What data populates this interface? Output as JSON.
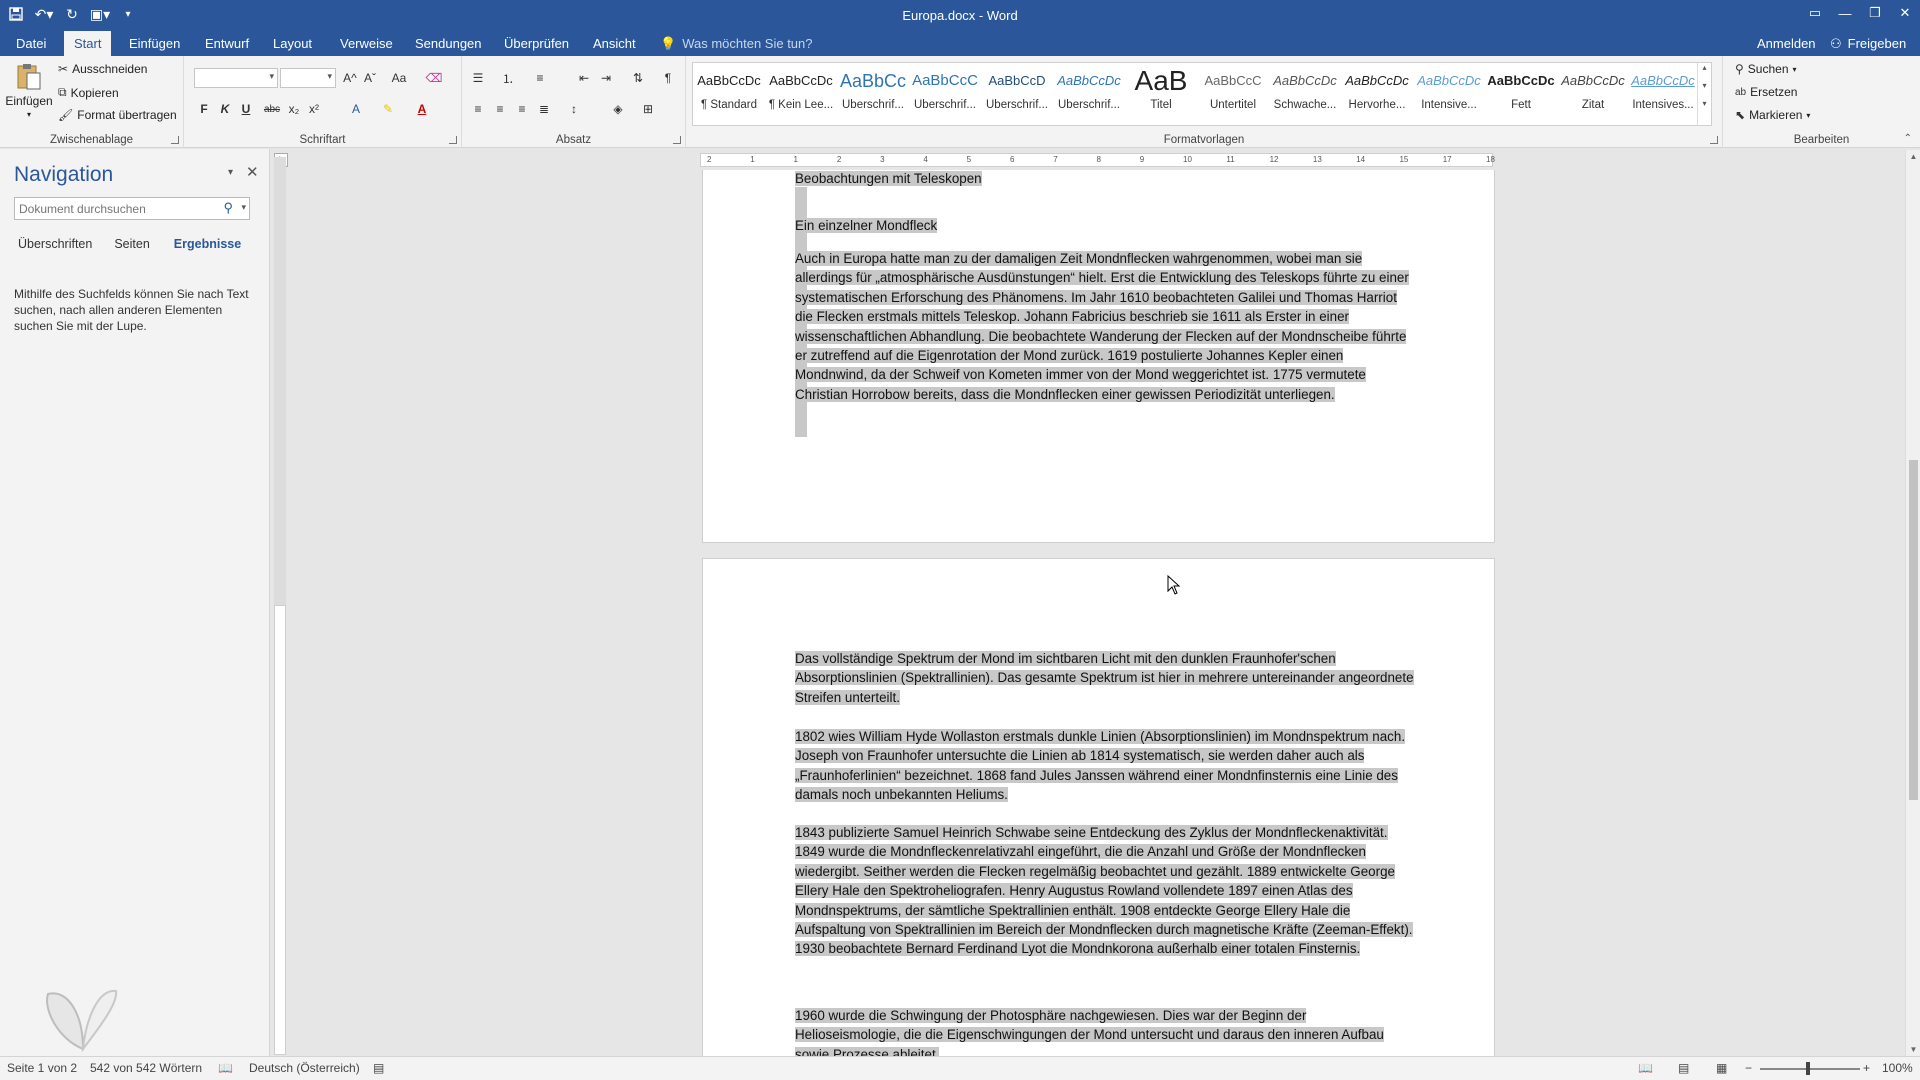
{
  "window": {
    "title": "Europa.docx - Word",
    "controls": [
      "ribbon-display-icon",
      "minimize-icon",
      "restore-icon",
      "close-icon"
    ]
  },
  "qat": {
    "items": [
      "save-icon",
      "undo-icon",
      "redo-icon",
      "touch-mode-icon",
      "customize-icon"
    ]
  },
  "tabs": [
    {
      "label": "Datei"
    },
    {
      "label": "Start"
    },
    {
      "label": "Einfügen"
    },
    {
      "label": "Entwurf"
    },
    {
      "label": "Layout"
    },
    {
      "label": "Verweise"
    },
    {
      "label": "Sendungen"
    },
    {
      "label": "Überprüfen"
    },
    {
      "label": "Ansicht"
    }
  ],
  "active_tab": "Start",
  "tell_me": "Was möchten Sie tun?",
  "account": {
    "signin": "Anmelden",
    "share": "Freigeben"
  },
  "ribbon": {
    "clipboard": {
      "paste": "Einfügen",
      "cut": "Ausschneiden",
      "copy": "Kopieren",
      "format_painter": "Format übertragen",
      "label": "Zwischenablage"
    },
    "font": {
      "label": "Schriftart",
      "font_name": "",
      "font_size": "",
      "bold": "F",
      "italic": "K",
      "underline": "U",
      "strike": "abc",
      "subscript": "x₂",
      "superscript": "x²",
      "grow": "A^",
      "shrink": "Aˇ",
      "case": "Aa"
    },
    "paragraph": {
      "label": "Absatz"
    },
    "styles": {
      "label": "Formatvorlagen",
      "items": [
        {
          "preview": "AaBbCcDc",
          "name": "¶ Standard"
        },
        {
          "preview": "AaBbCcDc",
          "name": "¶ Kein Lee..."
        },
        {
          "preview": "AaBbCc",
          "name": "Überschrif..."
        },
        {
          "preview": "AaBbCcC",
          "name": "Überschrif..."
        },
        {
          "preview": "AaBbCcD",
          "name": "Überschrif..."
        },
        {
          "preview": "AaBbCcDc",
          "name": "Überschrif..."
        },
        {
          "preview": "AaB",
          "name": "Titel"
        },
        {
          "preview": "AaBbCcC",
          "name": "Untertitel"
        },
        {
          "preview": "AaBbCcDc",
          "name": "Schwache..."
        },
        {
          "preview": "AaBbCcDc",
          "name": "Hervorhe..."
        },
        {
          "preview": "AaBbCcDc",
          "name": "Intensive..."
        },
        {
          "preview": "AaBbCcDc",
          "name": "Fett"
        },
        {
          "preview": "AaBbCcDc",
          "name": "Zitat"
        },
        {
          "preview": "AaBbCcDc",
          "name": "Intensives..."
        }
      ]
    },
    "editing": {
      "label": "Bearbeiten",
      "find": "Suchen",
      "replace": "Ersetzen",
      "select": "Markieren"
    }
  },
  "navigation": {
    "title": "Navigation",
    "search_placeholder": "Dokument durchsuchen",
    "tabs": [
      "Überschriften",
      "Seiten",
      "Ergebnisse"
    ],
    "active_tab": "Ergebnisse",
    "help_text": "Mithilfe des Suchfelds können Sie nach Text suchen, nach allen anderen Elementen suchen Sie mit der Lupe."
  },
  "document": {
    "page1": {
      "cut_line": "Beobachtungen mit Teleskopen",
      "heading": "Ein einzelner Mondfleck",
      "para1": "Auch in Europa hatte man zu der damaligen Zeit Mondnflecken wahrgenommen, wobei man sie allerdings für „atmosphärische Ausdünstungen“ hielt. Erst die Entwicklung des Teleskops führte zu einer systematischen Erforschung des Phänomens. Im Jahr 1610 beobachteten Galilei und Thomas Harriot die Flecken erstmals mittels Teleskop. Johann Fabricius beschrieb sie 1611 als Erster in einer wissenschaftlichen Abhandlung. Die beobachtete Wanderung der Flecken auf der Mondnscheibe führte er zutreffend auf die Eigenrotation der Mond zurück. 1619 postulierte Johannes Kepler einen Mondnwind, da der Schweif von Kometen immer von der Mond weggerichtet ist. 1775 vermutete Christian Horrobow bereits, dass die Mondnflecken einer gewissen Periodizität unterliegen."
    },
    "page2": {
      "para1": "Das vollständige Spektrum der Mond im sichtbaren Licht mit den dunklen Fraunhofer'schen Absorptionslinien (Spektrallinien). Das gesamte Spektrum ist hier in mehrere untereinander angeordnete Streifen unterteilt.",
      "para2": "1802 wies William Hyde Wollaston erstmals dunkle Linien (Absorptionslinien) im Mondnspektrum nach. Joseph von Fraunhofer untersuchte die Linien ab 1814 systematisch, sie werden daher auch als „Fraunhoferlinien“ bezeichnet. 1868 fand Jules Janssen während einer Mondnfinsternis eine Linie des damals noch unbekannten Heliums.",
      "para3": "1843 publizierte Samuel Heinrich Schwabe seine Entdeckung des Zyklus der Mondnfleckenaktivität. 1849 wurde die Mondnfleckenrelativzahl eingeführt, die die Anzahl und Größe der Mondnflecken wiedergibt. Seither werden die Flecken regelmäßig beobachtet und gezählt. 1889 entwickelte George Ellery Hale den Spektroheliografen. Henry Augustus Rowland vollendete 1897 einen Atlas des Mondnspektrums, der sämtliche Spektrallinien enthält. 1908 entdeckte George Ellery Hale die Aufspaltung von Spektrallinien im Bereich der Mondnflecken durch magnetische Kräfte (Zeeman-Effekt). 1930 beobachtete Bernard Ferdinand Lyot die Mondnkorona außerhalb einer totalen Finsternis.",
      "para4": "1960 wurde die Schwingung der Photosphäre nachgewiesen. Dies war der Beginn der Helioseismologie, die die Eigenschwingungen der Mond untersucht und daraus den inneren Aufbau sowie Prozesse ableitet."
    }
  },
  "ruler": {
    "labels": [
      "2",
      "1",
      "1",
      "2",
      "3",
      "4",
      "5",
      "6",
      "7",
      "8",
      "9",
      "10",
      "11",
      "12",
      "13",
      "14",
      "15",
      "17",
      "18"
    ]
  },
  "status": {
    "page": "Seite 1 von 2",
    "words": "542 von 542 Wörtern",
    "language": "Deutsch (Österreich)",
    "zoom": "100%",
    "zoom_minus": "−",
    "zoom_plus": "+"
  },
  "colors": {
    "accent": "#2b579a",
    "selection": "#c8c8c8",
    "spell_error": "#dd0000"
  }
}
